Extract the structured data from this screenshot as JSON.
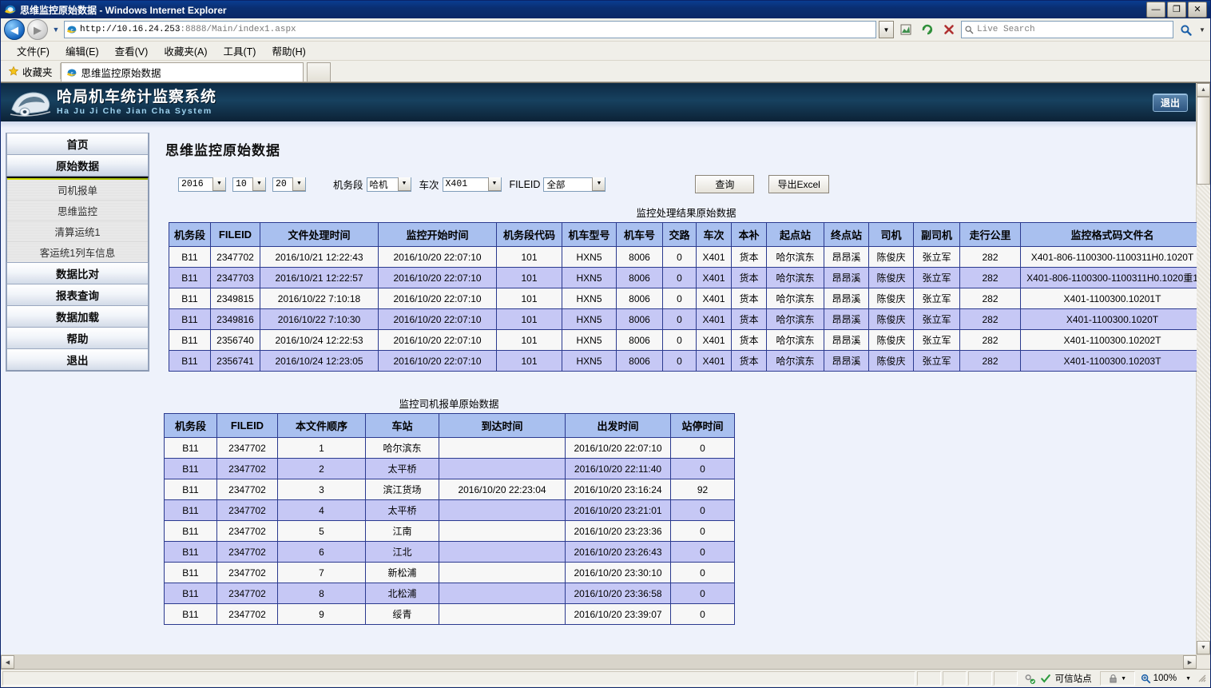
{
  "browser": {
    "window_title": "思维监控原始数据 - Windows Internet Explorer",
    "minimize_label": "—",
    "maximize_label": "❐",
    "close_label": "✕",
    "url_prefix": "http://10.16.24.253",
    "url_suffix": ":8888/Main/index1.aspx",
    "search_placeholder": "Live Search",
    "menus": [
      "文件(F)",
      "编辑(E)",
      "查看(V)",
      "收藏夹(A)",
      "工具(T)",
      "帮助(H)"
    ],
    "favorites_label": "收藏夹",
    "tab_title": "思维监控原始数据",
    "status_zone": "可信站点",
    "status_zoom": "100%"
  },
  "app": {
    "brand_cn": "哈局机车统计监察系统",
    "brand_en": "Ha Ju Ji Che Jian Cha System",
    "logout_label": "退出"
  },
  "sidebar": {
    "items": [
      {
        "label": "首页",
        "type": "main"
      },
      {
        "label": "原始数据",
        "type": "main",
        "active": true
      },
      {
        "label": "司机报单",
        "type": "sub"
      },
      {
        "label": "思维监控",
        "type": "sub"
      },
      {
        "label": "清算运统1",
        "type": "sub"
      },
      {
        "label": "客运统1列车信息",
        "type": "sub"
      },
      {
        "label": "数据比对",
        "type": "main"
      },
      {
        "label": "报表查询",
        "type": "main"
      },
      {
        "label": "数据加载",
        "type": "main"
      },
      {
        "label": "帮助",
        "type": "main"
      },
      {
        "label": "退出",
        "type": "main"
      }
    ]
  },
  "main": {
    "page_title": "思维监控原始数据",
    "filters": {
      "year": "2016",
      "month": "10",
      "day": "20",
      "depot_label": "机务段",
      "depot_value": "哈机",
      "train_label": "车次",
      "train_value": "X401",
      "fileid_label": "FILEID",
      "fileid_value": "全部",
      "query_button": "查询",
      "export_button": "导出Excel"
    },
    "table1": {
      "caption": "监控处理结果原始数据",
      "columns": [
        "机务段",
        "FILEID",
        "文件处理时间",
        "监控开始时间",
        "机务段代码",
        "机车型号",
        "机车号",
        "交路",
        "车次",
        "本补",
        "起点站",
        "终点站",
        "司机",
        "副司机",
        "走行公里",
        "监控格式码文件名"
      ],
      "rows": [
        [
          "B11",
          "2347702",
          "2016/10/21 12:22:43",
          "2016/10/20 22:07:10",
          "101",
          "HXN5",
          "8006",
          "0",
          "X401",
          "货本",
          "哈尔滨东",
          "昂昂溪",
          "陈俊庆",
          "张立军",
          "282",
          "X401-806-1100300-1100311H0.1020T"
        ],
        [
          "B11",
          "2347703",
          "2016/10/21 12:22:57",
          "2016/10/20 22:07:10",
          "101",
          "HXN5",
          "8006",
          "0",
          "X401",
          "货本",
          "哈尔滨东",
          "昂昂溪",
          "陈俊庆",
          "张立军",
          "282",
          "X401-806-1100300-1100311H0.1020重1"
        ],
        [
          "B11",
          "2349815",
          "2016/10/22 7:10:18",
          "2016/10/20 22:07:10",
          "101",
          "HXN5",
          "8006",
          "0",
          "X401",
          "货本",
          "哈尔滨东",
          "昂昂溪",
          "陈俊庆",
          "张立军",
          "282",
          "X401-1100300.10201T"
        ],
        [
          "B11",
          "2349816",
          "2016/10/22 7:10:30",
          "2016/10/20 22:07:10",
          "101",
          "HXN5",
          "8006",
          "0",
          "X401",
          "货本",
          "哈尔滨东",
          "昂昂溪",
          "陈俊庆",
          "张立军",
          "282",
          "X401-1100300.1020T"
        ],
        [
          "B11",
          "2356740",
          "2016/10/24 12:22:53",
          "2016/10/20 22:07:10",
          "101",
          "HXN5",
          "8006",
          "0",
          "X401",
          "货本",
          "哈尔滨东",
          "昂昂溪",
          "陈俊庆",
          "张立军",
          "282",
          "X401-1100300.10202T"
        ],
        [
          "B11",
          "2356741",
          "2016/10/24 12:23:05",
          "2016/10/20 22:07:10",
          "101",
          "HXN5",
          "8006",
          "0",
          "X401",
          "货本",
          "哈尔滨东",
          "昂昂溪",
          "陈俊庆",
          "张立军",
          "282",
          "X401-1100300.10203T"
        ]
      ]
    },
    "table2": {
      "caption": "监控司机报单原始数据",
      "columns": [
        "机务段",
        "FILEID",
        "本文件顺序",
        "车站",
        "到达时间",
        "出发时间",
        "站停时间"
      ],
      "rows": [
        [
          "B11",
          "2347702",
          "1",
          "哈尔滨东",
          "",
          "2016/10/20 22:07:10",
          "0"
        ],
        [
          "B11",
          "2347702",
          "2",
          "太平桥",
          "",
          "2016/10/20 22:11:40",
          "0"
        ],
        [
          "B11",
          "2347702",
          "3",
          "滨江货场",
          "2016/10/20 22:23:04",
          "2016/10/20 23:16:24",
          "92"
        ],
        [
          "B11",
          "2347702",
          "4",
          "太平桥",
          "",
          "2016/10/20 23:21:01",
          "0"
        ],
        [
          "B11",
          "2347702",
          "5",
          "江南",
          "",
          "2016/10/20 23:23:36",
          "0"
        ],
        [
          "B11",
          "2347702",
          "6",
          "江北",
          "",
          "2016/10/20 23:26:43",
          "0"
        ],
        [
          "B11",
          "2347702",
          "7",
          "新松浦",
          "",
          "2016/10/20 23:30:10",
          "0"
        ],
        [
          "B11",
          "2347702",
          "8",
          "北松浦",
          "",
          "2016/10/20 23:36:58",
          "0"
        ],
        [
          "B11",
          "2347702",
          "9",
          "绥青",
          "",
          "2016/10/20 23:39:07",
          "0"
        ]
      ]
    }
  }
}
